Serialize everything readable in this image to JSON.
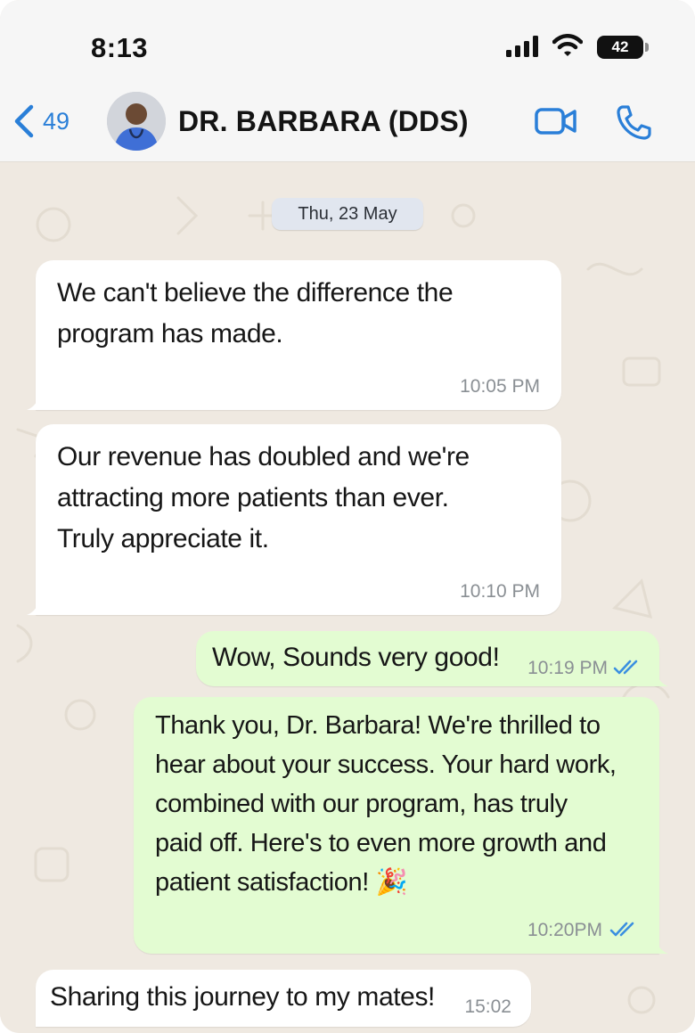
{
  "status_bar": {
    "time": "8:13",
    "battery": "42"
  },
  "header": {
    "back_count": "49",
    "contact_name": "DR. BARBARA (DDS)"
  },
  "date_chip": "Thu, 23 May",
  "messages": [
    {
      "direction": "incoming",
      "text": "We can't believe the difference the\nprogram has made.",
      "time": "10:05 PM"
    },
    {
      "direction": "incoming",
      "text": "Our revenue has doubled and we're\nattracting more patients than ever.\nTruly appreciate it.",
      "time": "10:10 PM"
    },
    {
      "direction": "outgoing",
      "text": "Wow, Sounds very good!",
      "time": "10:19 PM",
      "status": "read"
    },
    {
      "direction": "outgoing",
      "text": "Thank you, Dr. Barbara! We're thrilled to\nhear about your success. Your hard work,\ncombined with our program, has truly\npaid off. Here's to even more growth and\npatient satisfaction! 🎉",
      "time": "10:20PM",
      "status": "read"
    },
    {
      "direction": "incoming",
      "text": "Sharing this journey to my mates!",
      "time": "15:02"
    }
  ],
  "colors": {
    "accent": "#2a7fd8",
    "incoming_bubble": "#ffffff",
    "outgoing_bubble": "#e3fcd2",
    "wallpaper": "#efe9e1",
    "read_ticks": "#3b8fe0"
  },
  "icons": [
    "back-chevron-icon",
    "video-call-icon",
    "phone-call-icon",
    "signal-icon",
    "wifi-icon",
    "battery-icon",
    "double-check-icon"
  ]
}
